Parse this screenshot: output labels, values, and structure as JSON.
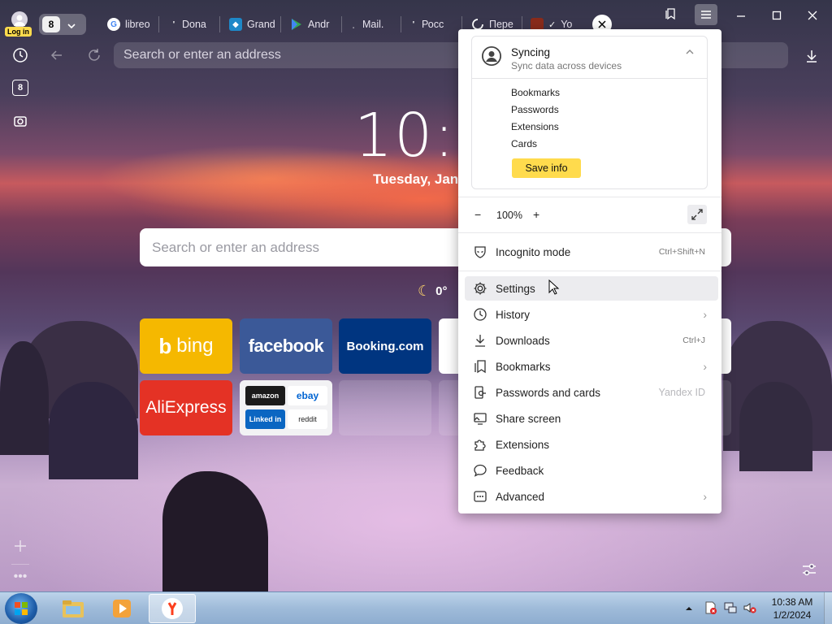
{
  "browser": {
    "login_label": "Log in",
    "tab_count": "8",
    "tabs": [
      {
        "label": "libreo",
        "favicon": "google-icon"
      },
      {
        "label": "Dona",
        "favicon": "generic-icon"
      },
      {
        "label": "Grand",
        "favicon": "grand-icon"
      },
      {
        "label": "Andr",
        "favicon": "google-play-icon"
      },
      {
        "label": "Mail.",
        "favicon": "mail-icon"
      },
      {
        "label": "Росс",
        "favicon": "generic-icon"
      },
      {
        "label": "Пере",
        "favicon": "loading-icon"
      },
      {
        "label": "Yo",
        "favicon": "image-icon"
      }
    ],
    "address_placeholder": "Search or enter an address",
    "sidebar_tab_count": "8"
  },
  "newtab": {
    "time": "10:3",
    "date": "Tuesday, Jan",
    "search_placeholder": "Search or enter an address",
    "weather": "0°",
    "tiles": [
      {
        "label": "bing",
        "color": "#f5b800"
      },
      {
        "label": "facebook",
        "color": "#3b5998"
      },
      {
        "label": "Booking.com",
        "color": "#003580"
      },
      {
        "label": "AliExpress",
        "color": "#e43225"
      }
    ],
    "mini_tiles": [
      "amazon",
      "ebay",
      "Linked in",
      "reddit"
    ]
  },
  "menu": {
    "sync": {
      "title": "Syncing",
      "subtitle": "Sync data across devices",
      "items": [
        "Bookmarks",
        "Passwords",
        "Extensions",
        "Cards"
      ],
      "button": "Save info"
    },
    "zoom": {
      "minus": "−",
      "value": "100%",
      "plus": "+"
    },
    "incognito": {
      "label": "Incognito mode",
      "shortcut": "Ctrl+Shift+N"
    },
    "items": [
      {
        "label": "Settings",
        "icon": "gear-icon"
      },
      {
        "label": "History",
        "icon": "clock-icon"
      },
      {
        "label": "Downloads",
        "icon": "download-icon",
        "shortcut": "Ctrl+J"
      },
      {
        "label": "Bookmarks",
        "icon": "bookmark-icon"
      },
      {
        "label": "Passwords and cards",
        "icon": "key-icon",
        "badge": "Yandex ID"
      },
      {
        "label": "Share screen",
        "icon": "share-screen-icon"
      },
      {
        "label": "Extensions",
        "icon": "puzzle-icon"
      },
      {
        "label": "Feedback",
        "icon": "speech-bubble-icon"
      },
      {
        "label": "Advanced",
        "icon": "more-icon"
      }
    ]
  },
  "taskbar": {
    "time": "10:38 AM",
    "date": "1/2/2024"
  },
  "colors": {
    "accent_yellow": "#ffdb4d",
    "menu_hover": "#ececef"
  }
}
